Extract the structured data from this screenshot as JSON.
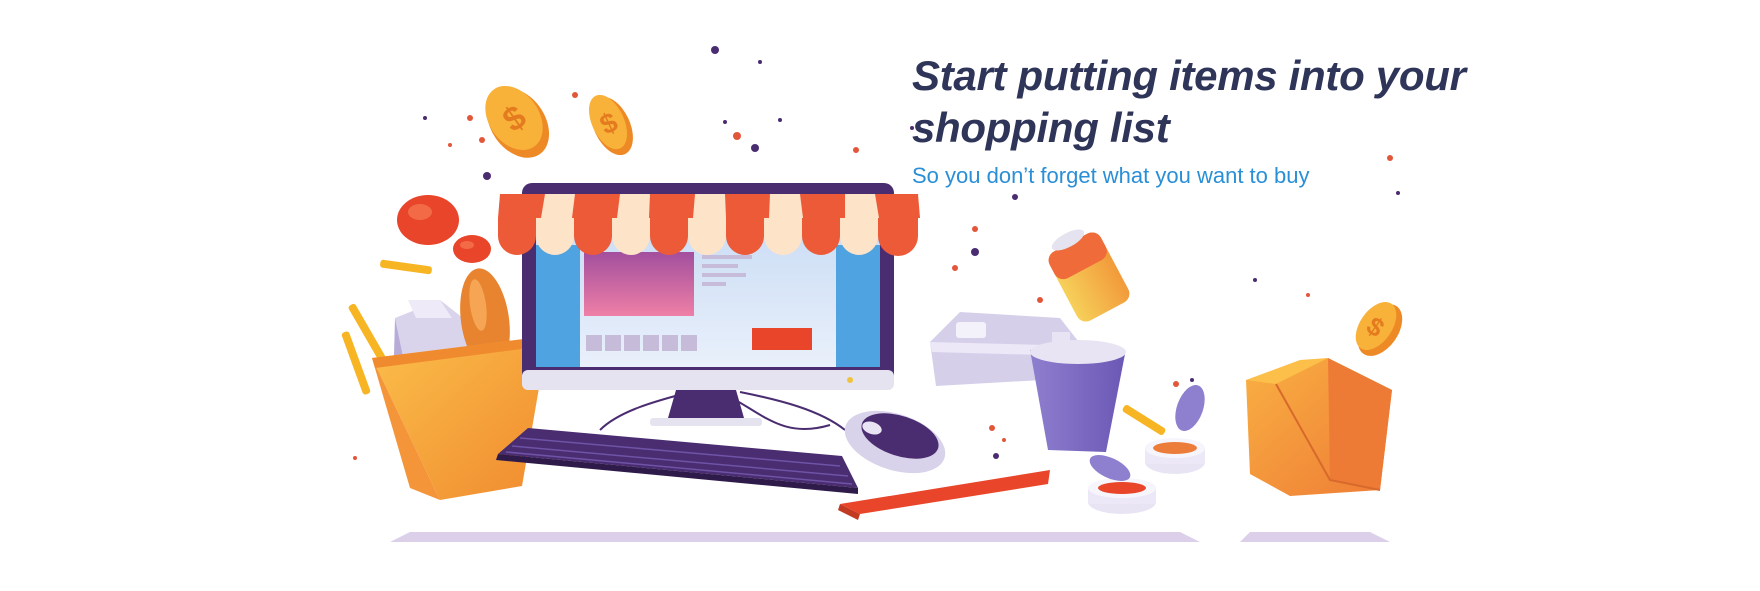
{
  "banner": {
    "headline": "Start putting items into your shopping list",
    "subline": "So you don’t forget what you want to buy"
  },
  "colors": {
    "headline": "#2e3558",
    "subline": "#2a8fd6",
    "awning_red": "#ec5a38",
    "awning_cream": "#fde3c8",
    "monitor_frame": "#4a2c70",
    "screen_blue": "#4fa3e0",
    "coin": "#f6a32a",
    "bag": "#f7a73c",
    "shadow": "#d9cce6"
  },
  "icons": [
    "shop-awning-icon",
    "coin-icon",
    "grocery-bag-icon",
    "monitor-icon",
    "keyboard-icon",
    "mouse-icon",
    "drink-can-icon",
    "food-box-icon",
    "cup-icon",
    "sauce-cup-icon",
    "tomato-icon",
    "bread-icon",
    "fries-icon"
  ]
}
